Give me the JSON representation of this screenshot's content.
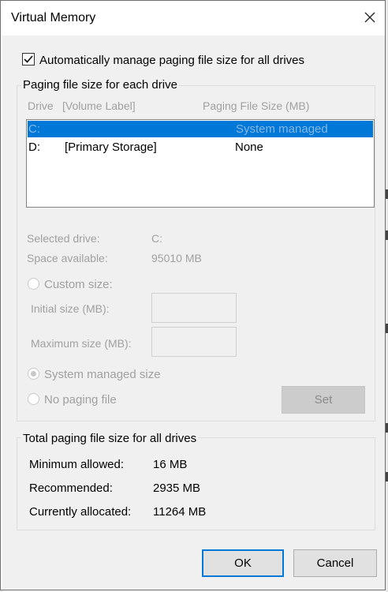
{
  "window": {
    "title": "Virtual Memory"
  },
  "auto_manage": {
    "label": "Automatically manage paging file size for all drives",
    "checked": true
  },
  "paging_group": {
    "title": "Paging file size for each drive",
    "headers": {
      "drive": "Drive",
      "volume_label": "[Volume Label]",
      "paging_size": "Paging File Size (MB)"
    },
    "drives": [
      {
        "drive": "C:",
        "label": "",
        "size": "System managed",
        "selected": true
      },
      {
        "drive": "D:",
        "label": "[Primary Storage]",
        "size": "None",
        "selected": false
      }
    ],
    "selected_drive_label": "Selected drive:",
    "selected_drive_value": "C:",
    "space_label": "Space available:",
    "space_value": "95010 MB",
    "custom_size_label": "Custom size:",
    "initial_size_label": "Initial size (MB):",
    "initial_size_value": "",
    "max_size_label": "Maximum size (MB):",
    "max_size_value": "",
    "system_managed_label": "System managed size",
    "no_paging_label": "No paging file",
    "set_button": "Set",
    "selected_option": "System managed size"
  },
  "total_group": {
    "title": "Total paging file size for all drives",
    "min_label": "Minimum allowed:",
    "min_value": "16 MB",
    "recommended_label": "Recommended:",
    "recommended_value": "2935 MB",
    "allocated_label": "Currently allocated:",
    "allocated_value": "11264 MB"
  },
  "buttons": {
    "ok": "OK",
    "cancel": "Cancel"
  },
  "colors": {
    "selection": "#0078d7",
    "disabled_text": "#a0a0a0",
    "dialog_bg": "#f0f0f0"
  },
  "icons": {
    "close": "close-icon",
    "checkbox": "checkmark-icon"
  }
}
